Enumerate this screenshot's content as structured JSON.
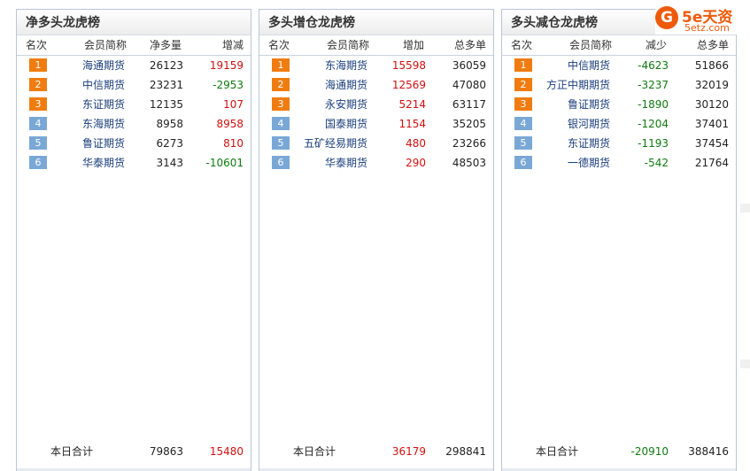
{
  "logo": {
    "brand": "5e天资",
    "url_text": "5etz.com",
    "glyph": "G"
  },
  "panels": [
    {
      "title": "净多头龙虎榜",
      "headers": [
        "名次",
        "会员简称",
        "净多量",
        "增减"
      ],
      "rows": [
        {
          "rank": "1",
          "name": "海通期货",
          "v1": "26123",
          "v2": "19159",
          "v2color": "red"
        },
        {
          "rank": "2",
          "name": "中信期货",
          "v1": "23231",
          "v2": "-2953",
          "v2color": "green"
        },
        {
          "rank": "3",
          "name": "东证期货",
          "v1": "12135",
          "v2": "107",
          "v2color": "red"
        },
        {
          "rank": "4",
          "name": "东海期货",
          "v1": "8958",
          "v2": "8958",
          "v2color": "red"
        },
        {
          "rank": "5",
          "name": "鲁证期货",
          "v1": "6273",
          "v2": "810",
          "v2color": "red"
        },
        {
          "rank": "6",
          "name": "华泰期货",
          "v1": "3143",
          "v2": "-10601",
          "v2color": "green"
        }
      ],
      "footer": {
        "label": "本日合计",
        "v1": "79863",
        "v2": "15480",
        "v1color": "plain",
        "v2color": "red"
      }
    },
    {
      "title": "多头增仓龙虎榜",
      "headers": [
        "名次",
        "会员简称",
        "增加",
        "总多单"
      ],
      "rows": [
        {
          "rank": "1",
          "name": "东海期货",
          "v1": "15598",
          "v2": "36059",
          "v1color": "red"
        },
        {
          "rank": "2",
          "name": "海通期货",
          "v1": "12569",
          "v2": "47080",
          "v1color": "red"
        },
        {
          "rank": "3",
          "name": "永安期货",
          "v1": "5214",
          "v2": "63117",
          "v1color": "red"
        },
        {
          "rank": "4",
          "name": "国泰期货",
          "v1": "1154",
          "v2": "35205",
          "v1color": "red"
        },
        {
          "rank": "5",
          "name": "五矿经易期货",
          "v1": "480",
          "v2": "23266",
          "v1color": "red"
        },
        {
          "rank": "6",
          "name": "华泰期货",
          "v1": "290",
          "v2": "48503",
          "v1color": "red"
        }
      ],
      "footer": {
        "label": "本日合计",
        "v1": "36179",
        "v2": "298841",
        "v1color": "red",
        "v2color": "plain"
      }
    },
    {
      "title": "多头减仓龙虎榜",
      "headers": [
        "名次",
        "会员简称",
        "减少",
        "总多单"
      ],
      "rows": [
        {
          "rank": "1",
          "name": "中信期货",
          "v1": "-4623",
          "v2": "51866",
          "v1color": "green"
        },
        {
          "rank": "2",
          "name": "方正中期期货",
          "v1": "-3237",
          "v2": "32019",
          "v1color": "green"
        },
        {
          "rank": "3",
          "name": "鲁证期货",
          "v1": "-1890",
          "v2": "30120",
          "v1color": "green"
        },
        {
          "rank": "4",
          "name": "银河期货",
          "v1": "-1204",
          "v2": "37401",
          "v1color": "green"
        },
        {
          "rank": "5",
          "name": "东证期货",
          "v1": "-1193",
          "v2": "37454",
          "v1color": "green"
        },
        {
          "rank": "6",
          "name": "一德期货",
          "v1": "-542",
          "v2": "21764",
          "v1color": "green"
        }
      ],
      "footer": {
        "label": "本日合计",
        "v1": "-20910",
        "v2": "388416",
        "v1color": "green",
        "v2color": "plain"
      }
    }
  ]
}
